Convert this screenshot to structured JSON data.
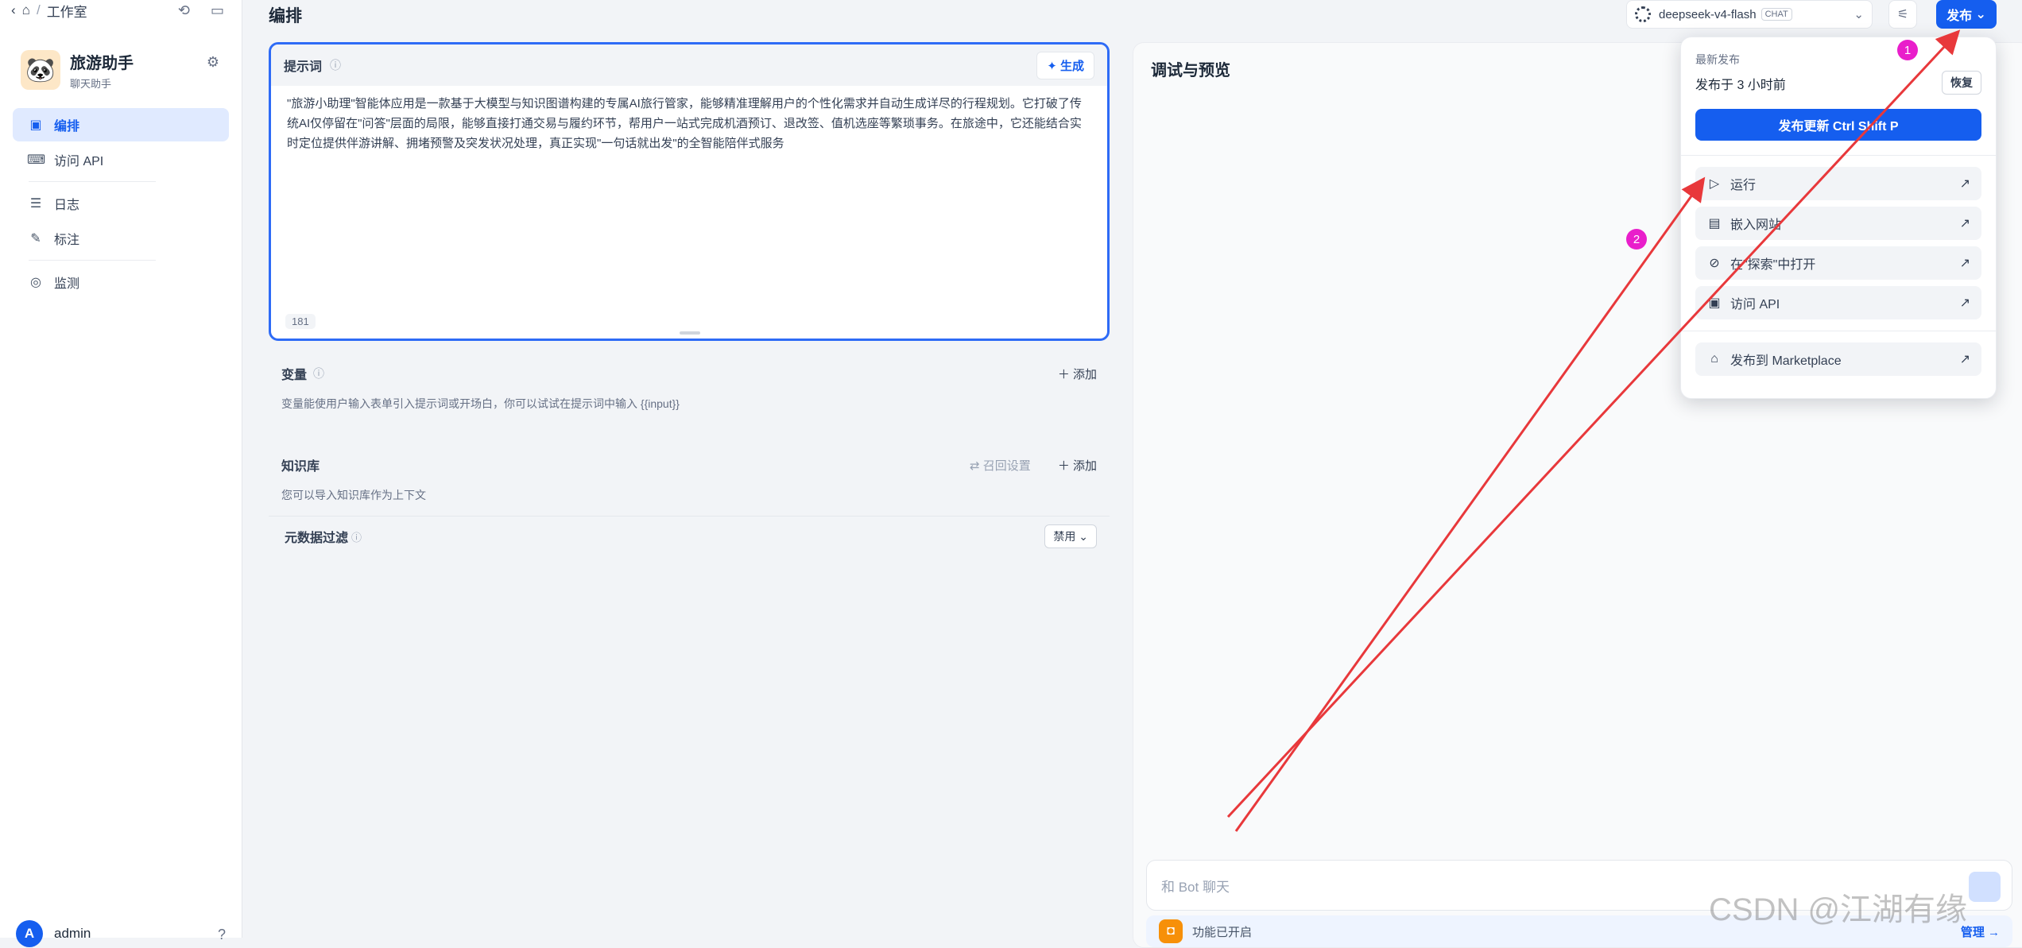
{
  "breadcrumb": {
    "workspace": "工作室"
  },
  "app": {
    "name": "旅游助手",
    "type": "聊天助手",
    "avatar_emoji": "🐼"
  },
  "nav": [
    {
      "label": "编排",
      "icon": "layout-icon",
      "active": true
    },
    {
      "label": "访问 API",
      "icon": "terminal-icon",
      "active": false
    },
    {
      "label": "日志",
      "icon": "log-icon",
      "active": false
    },
    {
      "label": "标注",
      "icon": "annotation-icon",
      "active": false
    },
    {
      "label": "监测",
      "icon": "monitor-icon",
      "active": false
    }
  ],
  "user": {
    "initial": "A",
    "name": "admin"
  },
  "header": {
    "title": "编排",
    "model": "deepseek-v4-flash",
    "model_tag": "CHAT",
    "publish": "发布"
  },
  "prompt": {
    "title": "提示词",
    "generate": "生成",
    "text": "\"旅游小助理\"智能体应用是一款基于大模型与知识图谱构建的专属AI旅行管家，能够精准理解用户的个性化需求并自动生成详尽的行程规划。它打破了传统AI仅停留在\"问答\"层面的局限，能够直接打通交易与履约环节，帮用户一站式完成机酒预订、退改签、值机选座等繁琐事务。在旅途中，它还能结合实时定位提供伴游讲解、拥堵预警及突发状况处理，真正实现\"一句话就出发\"的全智能陪伴式服务",
    "count": "181"
  },
  "variables": {
    "title": "变量",
    "add": "添加",
    "desc": "变量能使用户输入表单引入提示词或开场白，你可以试试在提示词中输入 {{input}}"
  },
  "knowledge": {
    "title": "知识库",
    "recall": "召回设置",
    "add": "添加",
    "desc": "您可以导入知识库作为上下文"
  },
  "metadata_filter": {
    "label": "元数据过滤",
    "value": "禁用"
  },
  "debug": {
    "title": "调试与预览",
    "input_placeholder": "和 Bot 聊天",
    "feature_text": "功能已开启",
    "manage": "管理"
  },
  "publish_popup": {
    "latest_label": "最新发布",
    "published_time": "发布于 3 小时前",
    "restore": "恢复",
    "update_button": "发布更新 Ctrl Shift P",
    "items": [
      {
        "label": "运行",
        "icon": "play-icon"
      },
      {
        "label": "嵌入网站",
        "icon": "embed-icon"
      },
      {
        "label": "在\"探索\"中打开",
        "icon": "explore-icon"
      },
      {
        "label": "访问 API",
        "icon": "api-icon"
      }
    ],
    "marketplace": "发布到 Marketplace"
  },
  "annotations": {
    "marker1": "1",
    "marker2": "2"
  },
  "watermark": "CSDN @江湖有缘",
  "colors": {
    "accent": "#155eef",
    "arrow": "#e8383b",
    "marker": "#e91ecb"
  }
}
